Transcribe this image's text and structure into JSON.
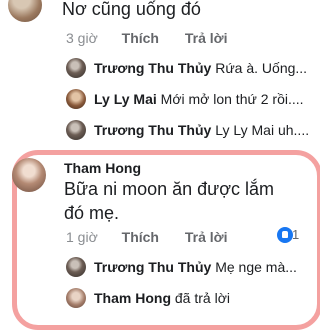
{
  "top_comment": {
    "text": "Nơ cũng uống đó",
    "time": "3 giờ",
    "like_label": "Thích",
    "reply_label": "Trả lời"
  },
  "top_replies": [
    {
      "name": "Trương Thu Thủy",
      "text": "Rứa à. Uống..."
    },
    {
      "name": "Ly Ly Mai",
      "text": "Mới mở lon thứ 2 rồi...."
    },
    {
      "name": "Trương Thu Thủy",
      "text": "Ly Ly Mai uh...."
    }
  ],
  "highlighted_comment": {
    "name": "Tham Hong",
    "text": "Bữa ni moon ăn được lắm đó mẹ.",
    "time": "1 giờ",
    "like_label": "Thích",
    "reply_label": "Trả lời",
    "reaction_count": "1",
    "reaction_icon": "like-icon",
    "highlight_color": "#f2908f"
  },
  "highlighted_replies": [
    {
      "name": "Trương Thu Thủy",
      "text": "Mẹ nge mà..."
    },
    {
      "name": "Tham Hong",
      "text": "đã trả lời"
    }
  ]
}
